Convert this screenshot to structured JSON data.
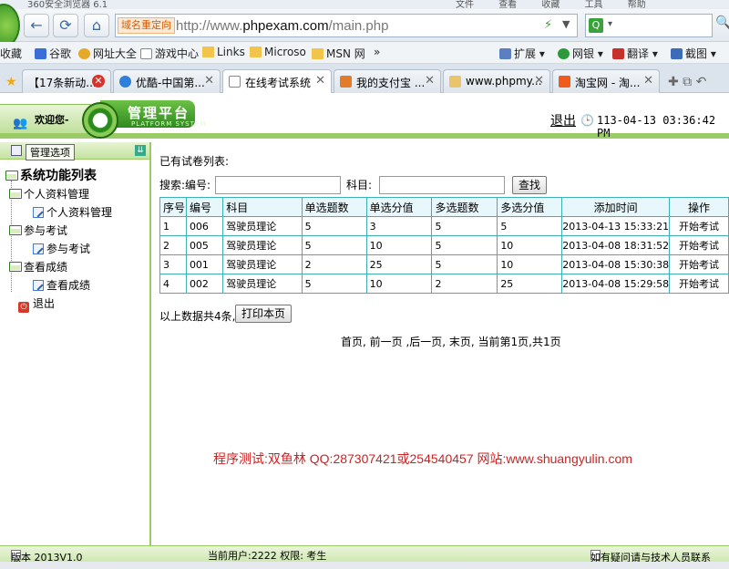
{
  "browser": {
    "app_title": "360安全浏览器 6.1",
    "menus": [
      "文件",
      "查看",
      "收藏",
      "工具",
      "帮助"
    ],
    "redirect_badge": "域名重定向",
    "url_prefix": "http://www.",
    "url_domain": "phpexam.com",
    "url_path": "/main.php",
    "bookmarks": [
      "收藏",
      "谷歌",
      "网址大全",
      "游戏中心",
      "Links",
      "Microso",
      "MSN 网",
      "»"
    ],
    "toolbar_right": [
      "扩展",
      "网银",
      "翻译",
      "截图"
    ],
    "tabs": [
      {
        "label": "【17条新动..."
      },
      {
        "label": "优酷-中国第..."
      },
      {
        "label": "在线考试系统"
      },
      {
        "label": "我的支付宝 ..."
      },
      {
        "label": "www.phpmy..."
      },
      {
        "label": "淘宝网 - 淘..."
      }
    ]
  },
  "header": {
    "welcome": "欢迎您-",
    "platform_title": "管理平台",
    "platform_sub": "PLATFORM SYSTEM",
    "logout": "退出",
    "datetime": "113-04-13 03:36:42 PM"
  },
  "sidebar": {
    "head_label": "管理选项",
    "root": "系统功能列表",
    "groups": [
      {
        "label": "个人资料管理",
        "child": "个人资料管理"
      },
      {
        "label": "参与考试",
        "child": "参与考试"
      },
      {
        "label": "查看成绩",
        "child": "查看成绩"
      }
    ],
    "exit": "退出"
  },
  "main": {
    "list_title": "已有试卷列表:",
    "search_label": "搜索:编号:",
    "subject_label": "科目:",
    "search_button": "查找",
    "columns": [
      "序号",
      "编号",
      "科目",
      "单选题数",
      "单选分值",
      "多选题数",
      "多选分值",
      "添加时间",
      "操作"
    ],
    "rows": [
      [
        "1",
        "006",
        "驾驶员理论",
        "5",
        "3",
        "5",
        "5",
        "2013-04-13 15:33:21",
        "开始考试"
      ],
      [
        "2",
        "005",
        "驾驶员理论",
        "5",
        "10",
        "5",
        "10",
        "2013-04-08 18:31:52",
        "开始考试"
      ],
      [
        "3",
        "001",
        "驾驶员理论",
        "2",
        "25",
        "5",
        "10",
        "2013-04-08 15:30:38",
        "开始考试"
      ],
      [
        "4",
        "002",
        "驾驶员理论",
        "5",
        "10",
        "2",
        "25",
        "2013-04-08 15:29:58",
        "开始考试"
      ]
    ],
    "total_text": "以上数据共4条,",
    "print_button": "打印本页",
    "pager": "首页, 前一页 ,后一页, 末页, 当前第1页,共1页",
    "credit": "程序测试:双鱼林 QQ:287307421或254540457 网站:www.shuangyulin.com"
  },
  "footer": {
    "version": "版本 2013V1.0",
    "current_user": "当前用户:2222 权限: 考生",
    "help": "如有疑问请与技术人员联系"
  }
}
